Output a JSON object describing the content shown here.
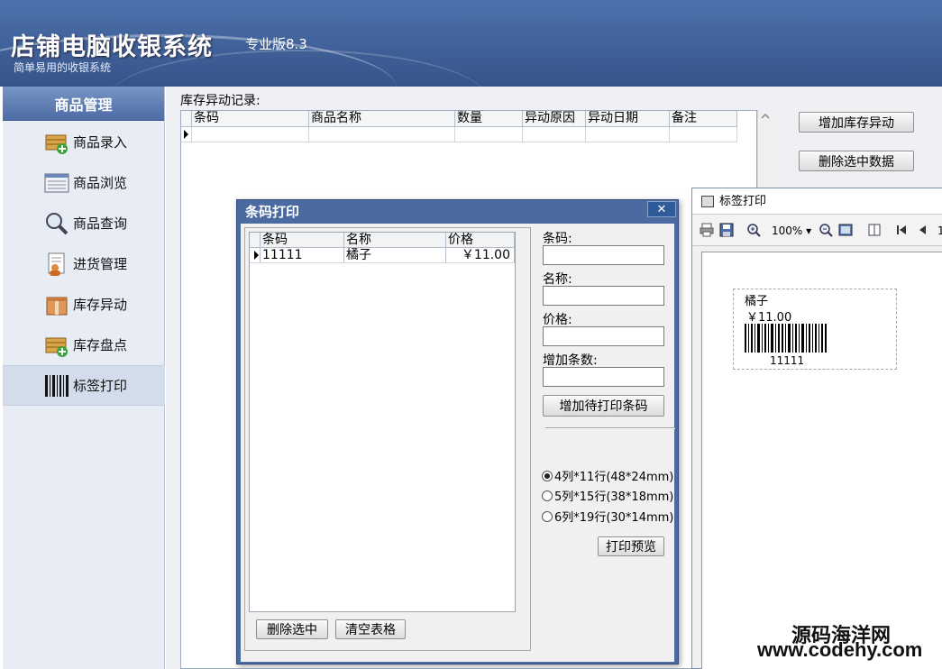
{
  "header": {
    "title": "店铺电脑收银系统",
    "version": "专业版8.3",
    "subtitle": "简单易用的收银系统"
  },
  "sidebar": {
    "header": "商品管理",
    "items": [
      {
        "label": "商品录入",
        "icon": "box-add-icon"
      },
      {
        "label": "商品浏览",
        "icon": "list-window-icon"
      },
      {
        "label": "商品查询",
        "icon": "magnifier-icon"
      },
      {
        "label": "进货管理",
        "icon": "document-user-icon"
      },
      {
        "label": "库存异动",
        "icon": "package-icon"
      },
      {
        "label": "库存盘点",
        "icon": "box-add-icon"
      },
      {
        "label": "标签打印",
        "icon": "barcode-icon",
        "active": true
      }
    ]
  },
  "main": {
    "record_label": "库存异动记录:",
    "columns": [
      "条码",
      "商品名称",
      "数量",
      "异动原因",
      "异动日期",
      "备注"
    ],
    "buttons": {
      "add_stock_change": "增加库存异动",
      "delete_selected": "删除选中数据"
    }
  },
  "barcode_dialog": {
    "title": "条码打印",
    "close": "✕",
    "columns": [
      "条码",
      "名称",
      "价格"
    ],
    "rows": [
      {
        "barcode": "11111",
        "name": "橘子",
        "price": "￥11.00"
      }
    ],
    "fields": {
      "barcode_label": "条码:",
      "name_label": "名称:",
      "price_label": "价格:",
      "count_label": "增加条数:"
    },
    "add_button": "增加待打印条码",
    "layouts": [
      {
        "label": "4列*11行(48*24mm)",
        "selected": true
      },
      {
        "label": "5列*15行(38*18mm)",
        "selected": false
      },
      {
        "label": "6列*19行(30*14mm)",
        "selected": false
      }
    ],
    "preview_button": "打印预览",
    "delete_button": "删除选中",
    "clear_button": "清空表格"
  },
  "preview": {
    "title": "标签打印",
    "zoom": "100%",
    "page_number": "1",
    "label": {
      "name": "橘子",
      "price": "￥11.00",
      "barcode": "11111"
    }
  },
  "watermark": {
    "line1": "源码海洋网",
    "line2": "www.codehy.com"
  }
}
